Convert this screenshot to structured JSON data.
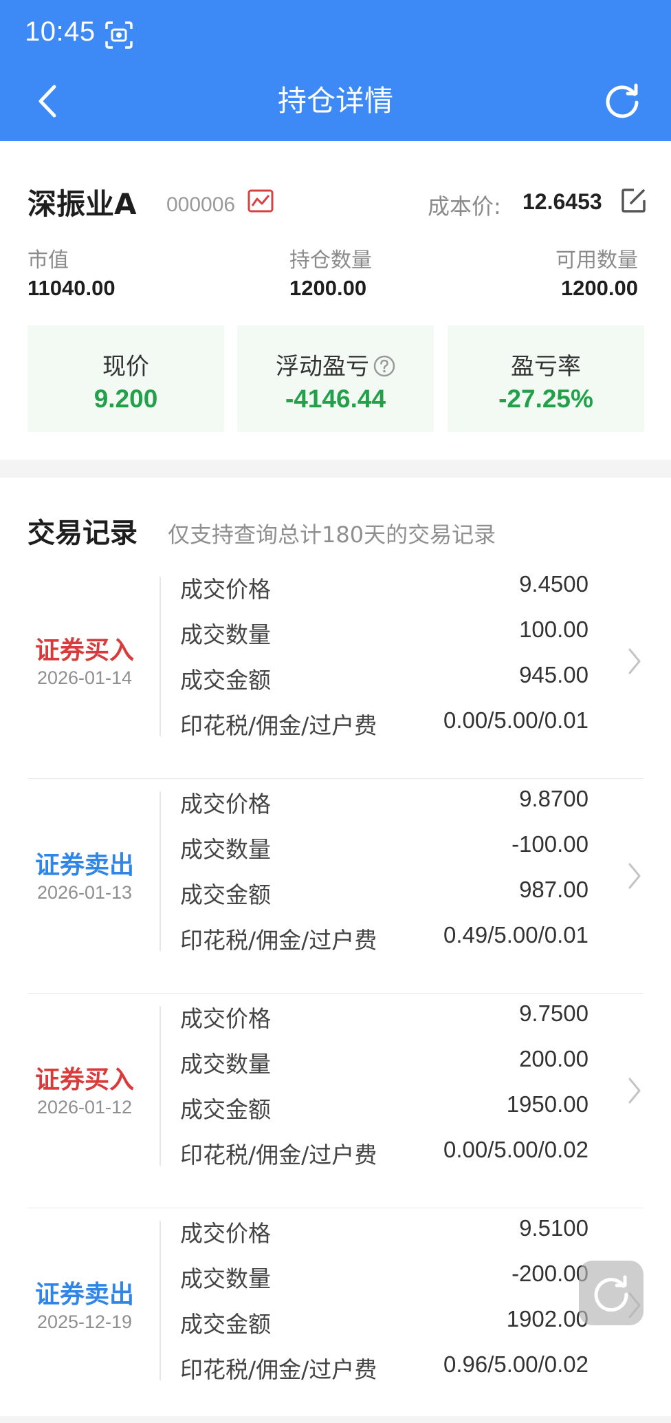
{
  "status": {
    "time": "10:45"
  },
  "header": {
    "title": "持仓详情"
  },
  "stock": {
    "name": "深振业A",
    "code": "000006",
    "cost_label": "成本价:",
    "cost_value": "12.6453"
  },
  "metrics": [
    {
      "label": "市值",
      "value": "11040.00"
    },
    {
      "label": "持仓数量",
      "value": "1200.00"
    },
    {
      "label": "可用数量",
      "value": "1200.00"
    }
  ],
  "boxes": [
    {
      "label": "现价",
      "value": "9.200"
    },
    {
      "label": "浮动盈亏",
      "value": "-4146.44"
    },
    {
      "label": "盈亏率",
      "value": "-27.25%"
    }
  ],
  "records": {
    "title": "交易记录",
    "subtitle": "仅支持查询总计180天的交易记录",
    "field_labels": [
      "成交价格",
      "成交数量",
      "成交金额",
      "印花税/佣金/过户费"
    ],
    "items": [
      {
        "type": "证券买入",
        "kind": "buy",
        "date": "2026-01-14",
        "price": "9.4500",
        "qty": "100.00",
        "amount": "945.00",
        "fees": "0.00/5.00/0.01"
      },
      {
        "type": "证券卖出",
        "kind": "sell",
        "date": "2026-01-13",
        "price": "9.8700",
        "qty": "-100.00",
        "amount": "987.00",
        "fees": "0.49/5.00/0.01"
      },
      {
        "type": "证券买入",
        "kind": "buy",
        "date": "2026-01-12",
        "price": "9.7500",
        "qty": "200.00",
        "amount": "1950.00",
        "fees": "0.00/5.00/0.02"
      },
      {
        "type": "证券卖出",
        "kind": "sell",
        "date": "2025-12-19",
        "price": "9.5100",
        "qty": "-200.00",
        "amount": "1902.00",
        "fees": "0.96/5.00/0.02"
      }
    ]
  },
  "colors": {
    "header_bg": "#3d8af7",
    "buy": "#d93a3a",
    "sell": "#2f86e8",
    "loss_green": "#22a04a"
  },
  "icons": [
    "screenshot-icon",
    "back-arrow-icon",
    "refresh-icon",
    "chart-icon",
    "edit-icon",
    "help-icon",
    "chevron-right-icon",
    "floating-refresh-icon"
  ]
}
